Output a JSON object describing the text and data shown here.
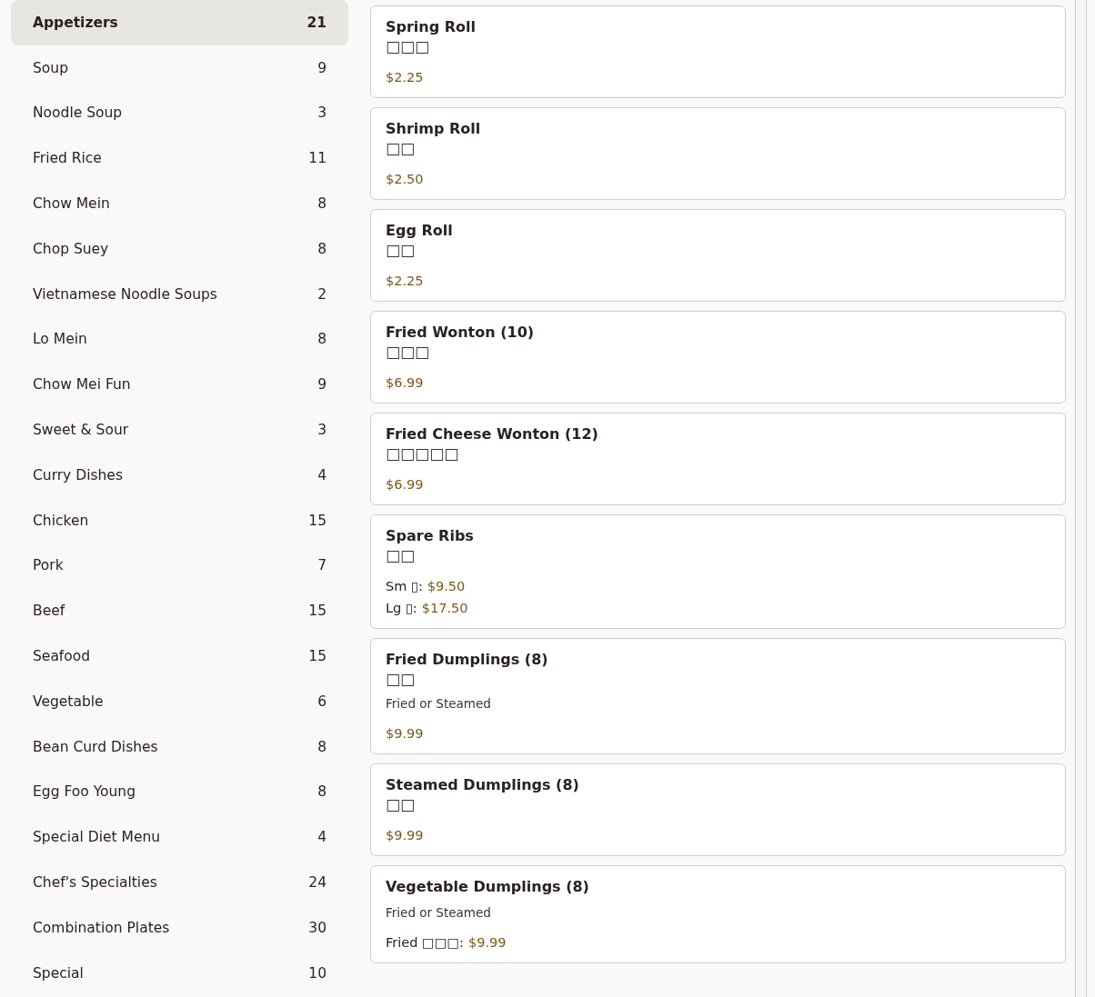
{
  "categories": [
    {
      "label": "Appetizers",
      "count": "21",
      "selected": true
    },
    {
      "label": "Soup",
      "count": "9",
      "selected": false
    },
    {
      "label": "Noodle Soup",
      "count": "3",
      "selected": false
    },
    {
      "label": "Fried Rice",
      "count": "11",
      "selected": false
    },
    {
      "label": "Chow Mein",
      "count": "8",
      "selected": false
    },
    {
      "label": "Chop Suey",
      "count": "8",
      "selected": false
    },
    {
      "label": "Vietnamese Noodle Soups",
      "count": "2",
      "selected": false
    },
    {
      "label": "Lo Mein",
      "count": "8",
      "selected": false
    },
    {
      "label": "Chow Mei Fun",
      "count": "9",
      "selected": false
    },
    {
      "label": "Sweet & Sour",
      "count": "3",
      "selected": false
    },
    {
      "label": "Curry Dishes",
      "count": "4",
      "selected": false
    },
    {
      "label": "Chicken",
      "count": "15",
      "selected": false
    },
    {
      "label": "Pork",
      "count": "7",
      "selected": false
    },
    {
      "label": "Beef",
      "count": "15",
      "selected": false
    },
    {
      "label": "Seafood",
      "count": "15",
      "selected": false
    },
    {
      "label": "Vegetable",
      "count": "6",
      "selected": false
    },
    {
      "label": "Bean Curd Dishes",
      "count": "8",
      "selected": false
    },
    {
      "label": "Egg Foo Young",
      "count": "8",
      "selected": false
    },
    {
      "label": "Special Diet Menu",
      "count": "4",
      "selected": false
    },
    {
      "label": "Chef's Specialties",
      "count": "24",
      "selected": false
    },
    {
      "label": "Combination Plates",
      "count": "30",
      "selected": false
    },
    {
      "label": "Special",
      "count": "10",
      "selected": false
    }
  ],
  "items": [
    {
      "name": "Spring Roll",
      "chinese": "□□□",
      "prices": [
        {
          "amount": "$2.25"
        }
      ]
    },
    {
      "name": "Shrimp Roll",
      "chinese": "□□",
      "prices": [
        {
          "amount": "$2.50"
        }
      ]
    },
    {
      "name": "Egg Roll",
      "chinese": "□□",
      "prices": [
        {
          "amount": "$2.25"
        }
      ]
    },
    {
      "name": "Fried Wonton (10)",
      "chinese": "□□□",
      "prices": [
        {
          "amount": "$6.99"
        }
      ]
    },
    {
      "name": "Fried Cheese Wonton (12)",
      "chinese": "□□□□□",
      "prices": [
        {
          "amount": "$6.99"
        }
      ]
    },
    {
      "name": "Spare Ribs",
      "chinese": "□□",
      "prices": [
        {
          "label": "Sm ▯:",
          "amount": "$9.50"
        },
        {
          "label": "Lg ▯:",
          "amount": "$17.50"
        }
      ]
    },
    {
      "name": "Fried Dumplings (8)",
      "chinese": "□□",
      "note": "Fried or Steamed",
      "prices": [
        {
          "amount": "$9.99"
        }
      ]
    },
    {
      "name": "Steamed Dumplings (8)",
      "chinese": "□□",
      "prices": [
        {
          "amount": "$9.99"
        }
      ]
    },
    {
      "name": "Vegetable Dumplings (8)",
      "note": "Fried or Steamed",
      "prices": [
        {
          "label": "Fried □□□:",
          "amount": "$9.99"
        }
      ]
    }
  ]
}
